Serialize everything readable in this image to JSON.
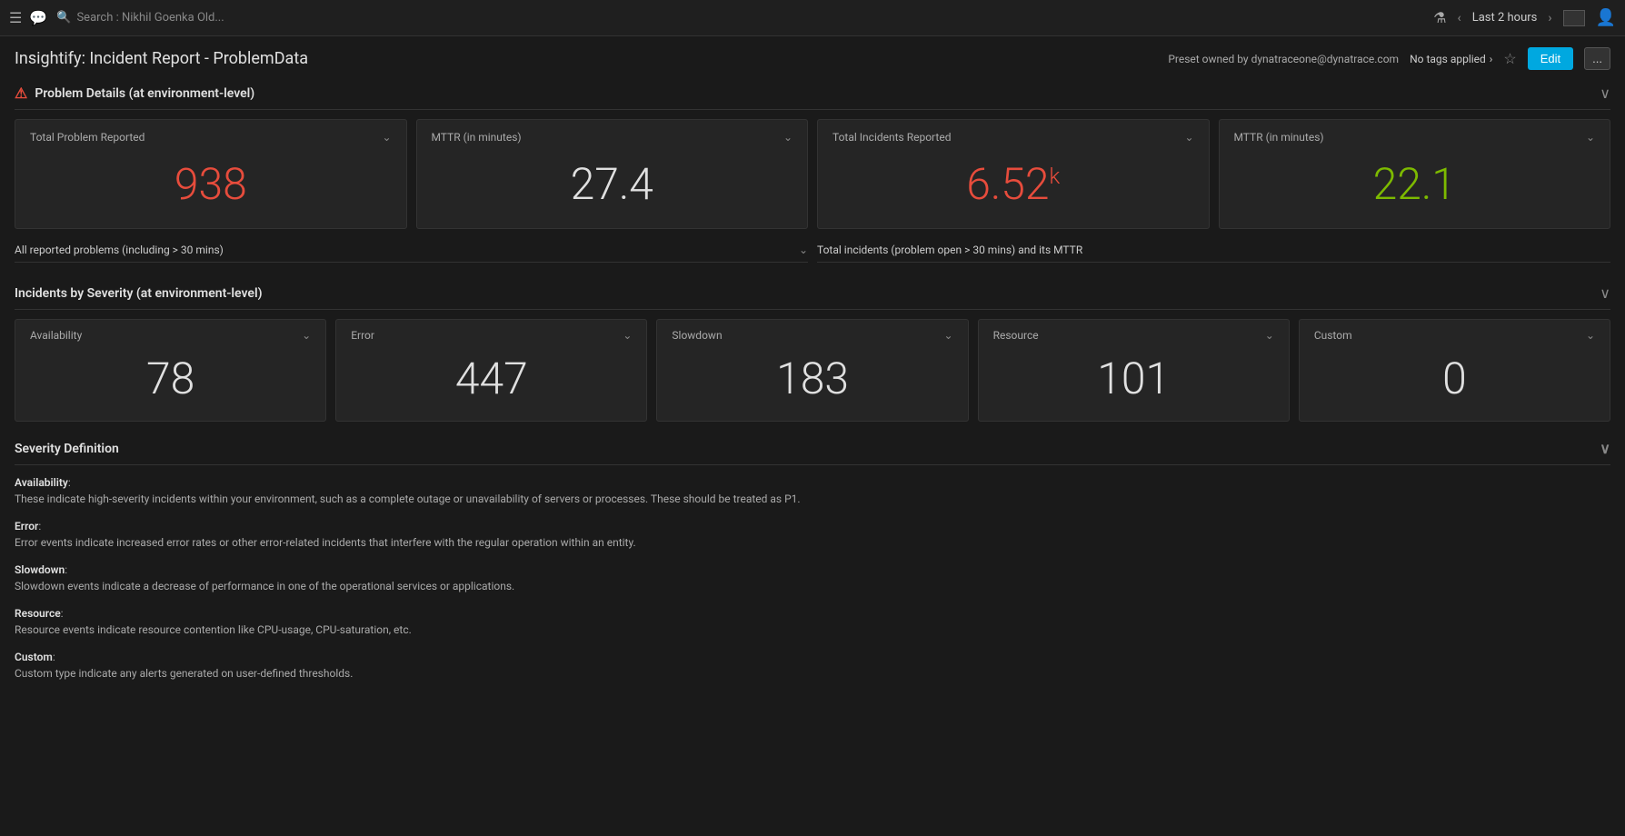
{
  "topbar": {
    "search_placeholder": "Search : Nikhil Goenka Old...",
    "time_range": "Last 2 hours"
  },
  "header": {
    "title": "Insightify: Incident Report - ProblemData",
    "preset_label": "Preset owned by dynatraceone@dynatrace.com",
    "tags_label": "No tags applied",
    "edit_label": "Edit",
    "more_label": "..."
  },
  "problem_details": {
    "section_title": "Problem Details (at environment-level)",
    "cards": [
      {
        "label": "Total Problem Reported",
        "value": "938",
        "color": "red"
      },
      {
        "label": "MTTR (in minutes)",
        "value": "27.4",
        "color": "white"
      }
    ],
    "right_cards": [
      {
        "label": "Total Incidents Reported",
        "value": "6.52",
        "suffix": "k",
        "color": "red"
      },
      {
        "label": "MTTR (in minutes)",
        "value": "22.1",
        "color": "green"
      }
    ],
    "left_subtitle": "All reported problems (including > 30 mins)",
    "right_subtitle": "Total incidents (problem open > 30 mins) and its MTTR"
  },
  "incidents_severity": {
    "section_title": "Incidents by Severity (at environment-level)",
    "cards": [
      {
        "label": "Availability",
        "value": "78"
      },
      {
        "label": "Error",
        "value": "447"
      },
      {
        "label": "Slowdown",
        "value": "183"
      },
      {
        "label": "Resource",
        "value": "101"
      },
      {
        "label": "Custom",
        "value": "0"
      }
    ]
  },
  "severity_definition": {
    "section_title": "Severity Definition",
    "items": [
      {
        "term": "Availability",
        "definition": "These indicate high-severity incidents within your environment, such as a complete outage or unavailability of servers or processes. These should be treated as P1."
      },
      {
        "term": "Error",
        "definition": "Error events indicate increased error rates or other error-related incidents that interfere with the regular operation within an entity."
      },
      {
        "term": "Slowdown",
        "definition": "Slowdown events indicate a decrease of performance in one of the operational services or applications."
      },
      {
        "term": "Resource",
        "definition": "Resource events indicate resource contention like CPU-usage, CPU-saturation, etc."
      },
      {
        "term": "Custom",
        "definition": "Custom type indicate any alerts generated on user-defined thresholds."
      }
    ]
  }
}
